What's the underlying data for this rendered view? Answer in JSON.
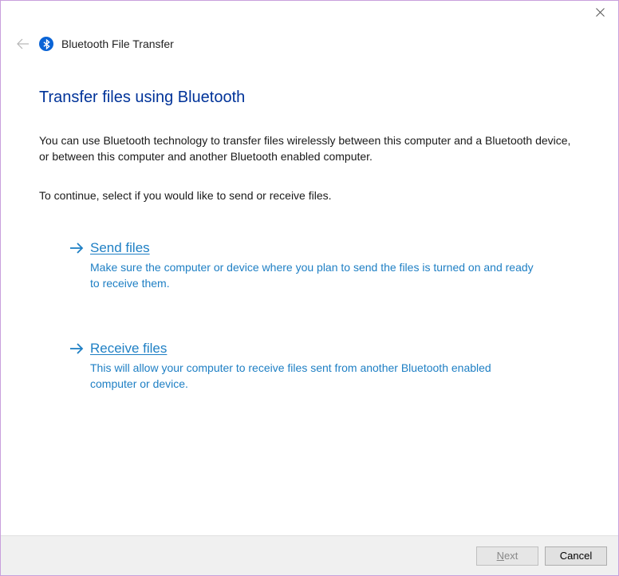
{
  "header": {
    "title": "Bluetooth File Transfer"
  },
  "main": {
    "heading": "Transfer files using Bluetooth",
    "intro": "You can use Bluetooth technology to transfer files wirelessly between this computer and a Bluetooth device, or between this computer and another Bluetooth enabled computer.",
    "instruction": "To continue, select if you would like to send or receive files."
  },
  "options": {
    "send": {
      "title": "Send files",
      "desc": "Make sure the computer or device where you plan to send the files is turned on and ready to receive them."
    },
    "receive": {
      "title": "Receive files",
      "desc": "This will allow your computer to receive files sent from another Bluetooth enabled computer or device."
    }
  },
  "footer": {
    "next_access": "N",
    "next_rest": "ext",
    "cancel": "Cancel"
  }
}
